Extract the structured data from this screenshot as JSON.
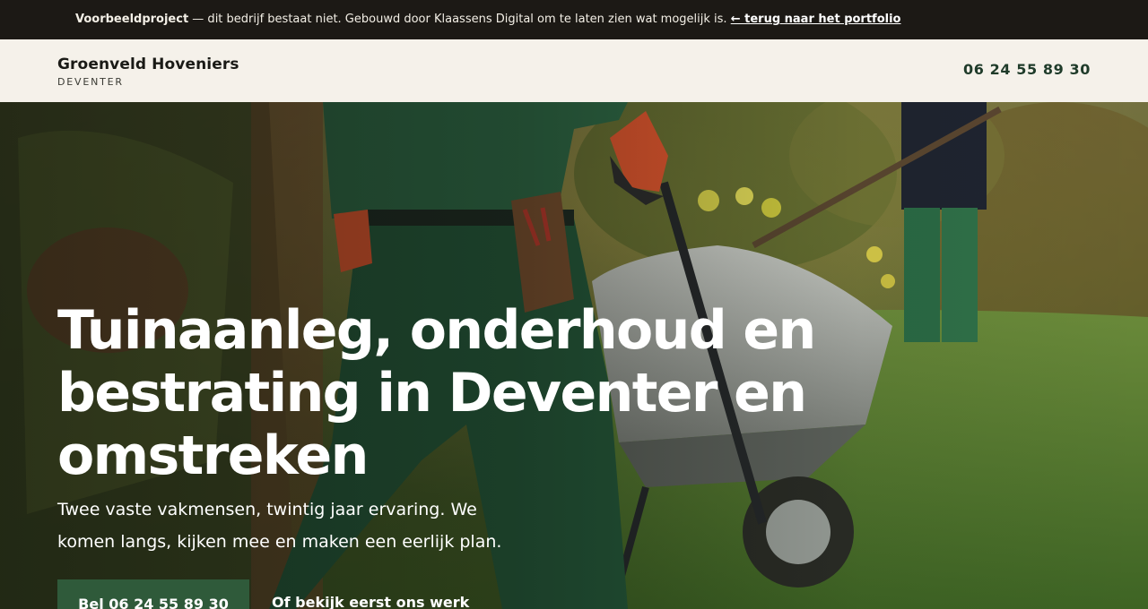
{
  "notice": {
    "bold": "Voorbeeldproject",
    "text": " — dit bedrijf bestaat niet. Gebouwd door Klaassens Digital om te laten zien wat mogelijk is. ",
    "link": "← terug naar het portfolio"
  },
  "header": {
    "brand_name": "Groenveld Hoveniers",
    "brand_city": "DEVENTER",
    "phone": "06 24 55 89 30"
  },
  "hero": {
    "title": "Tuinaanleg, onderhoud en bestrating in Deventer en omstreken",
    "subtitle": "Twee vaste vakmensen, twintig jaar ervaring. We komen langs, kijken mee en maken een eerlijk plan.",
    "cta_primary": "Bel 06 24 55 89 30",
    "cta_secondary": "Of bekijk eerst ons werk"
  },
  "colors": {
    "notice_bg": "#1c1915",
    "header_bg": "#f5f1ea",
    "accent_green": "#2f5a3a",
    "phone_text": "#1f3b2a"
  }
}
